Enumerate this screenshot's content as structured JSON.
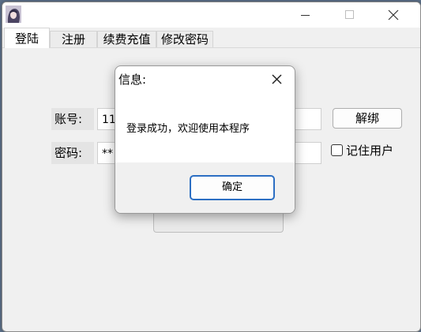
{
  "window": {
    "tabs": [
      "登陆",
      "注册",
      "续费充值",
      "修改密码"
    ],
    "active_tab": "登陆"
  },
  "form": {
    "account_label": "账号:",
    "account_value": "11",
    "password_label": "密码:",
    "password_value": "**",
    "unbind_label": "解绑",
    "remember_label": "记住用户",
    "remember_checked": false
  },
  "dialog": {
    "title": "信息:",
    "message": "登录成功，欢迎使用本程序",
    "ok_label": "确定"
  },
  "icons": {
    "minimize": "minimize-icon",
    "maximize": "maximize-icon",
    "close": "close-icon",
    "dialog_close": "close-icon",
    "app": "app-avatar-icon"
  },
  "colors": {
    "window_bg": "#f0f0f0",
    "dialog_ok_border": "#2c6fc3"
  }
}
